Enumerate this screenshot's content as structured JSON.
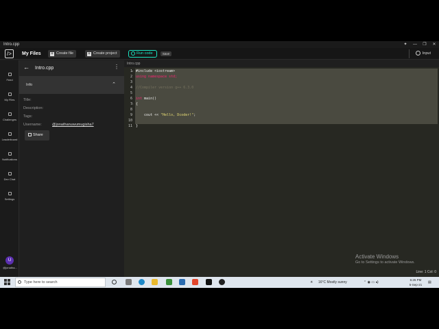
{
  "window": {
    "title": "Intro.cpp",
    "controls": [
      "✦",
      "—",
      "❐",
      "✕"
    ]
  },
  "topbar": {
    "logo_glyph": "/>",
    "title": "My Files",
    "create_file_label": "Create file",
    "create_project_label": "Create project",
    "run_label": "Run code",
    "save_label": "Save",
    "input_label": "Input"
  },
  "nav": {
    "items": [
      {
        "label": "Feed",
        "icon": "feed-icon"
      },
      {
        "label": "My Files",
        "icon": "files-icon"
      },
      {
        "label": "Challenges",
        "icon": "challenges-icon"
      },
      {
        "label": "Leaderboard",
        "icon": "leaderboard-icon"
      },
      {
        "label": "Notifications",
        "icon": "bell-icon"
      },
      {
        "label": "Dev Chat",
        "icon": "chat-icon"
      },
      {
        "label": "Settings",
        "icon": "gear-icon"
      }
    ],
    "avatar_initial": "U",
    "avatar_name": "@jonatha..."
  },
  "file_panel": {
    "back_glyph": "←",
    "filename": "Intro.cpp",
    "kebab_glyph": "⋮",
    "info_label": "Info",
    "chevron_glyph": "⌃",
    "fields": {
      "title_label": "Title:",
      "description_label": "Description:",
      "tags_label": "Tags:",
      "username_label": "Username:",
      "username_value": "@jonathanuwumugisha7"
    },
    "share_label": "Share"
  },
  "editor": {
    "tab_label": "Intro.cpp",
    "line_numbers": [
      "1",
      "2",
      "3",
      "4",
      "5",
      "6",
      "7",
      "8",
      "9",
      "10",
      "11"
    ],
    "fold_markers": {
      "1": "▾",
      "7": "▾"
    },
    "code": {
      "l1": "#include <iostream>",
      "l2_kw": "using namespace",
      "l2_rest": " std;",
      "l4": "//Compiler version g++ 6.3.0",
      "l6_kw": "int",
      "l6_rest": " main()",
      "l7": "{",
      "l9_pre": "    cout << ",
      "l9_str": "\"Hello, Dcoder!\"",
      "l9_post": ";",
      "l11": "}"
    },
    "status": "Line: 1 Col: 0"
  },
  "watermark": {
    "line1": "Activate Windows",
    "line2": "Go to Settings to activate Windows."
  },
  "taskbar": {
    "search_placeholder": "Type here to search",
    "weather": "16°C  Mostly sunny",
    "time": "6:26 PM",
    "date": "5-Sep-21",
    "tray_glyphs": "⌃  ◉  ▭  ◂)"
  },
  "colors": {
    "accent_run": "#19e6c3",
    "editor_bg": "#272822",
    "selection": "#4a4a40",
    "keyword": "#f92672",
    "string": "#e6db74",
    "comment": "#75715e",
    "avatar": "#5b2fb0"
  }
}
